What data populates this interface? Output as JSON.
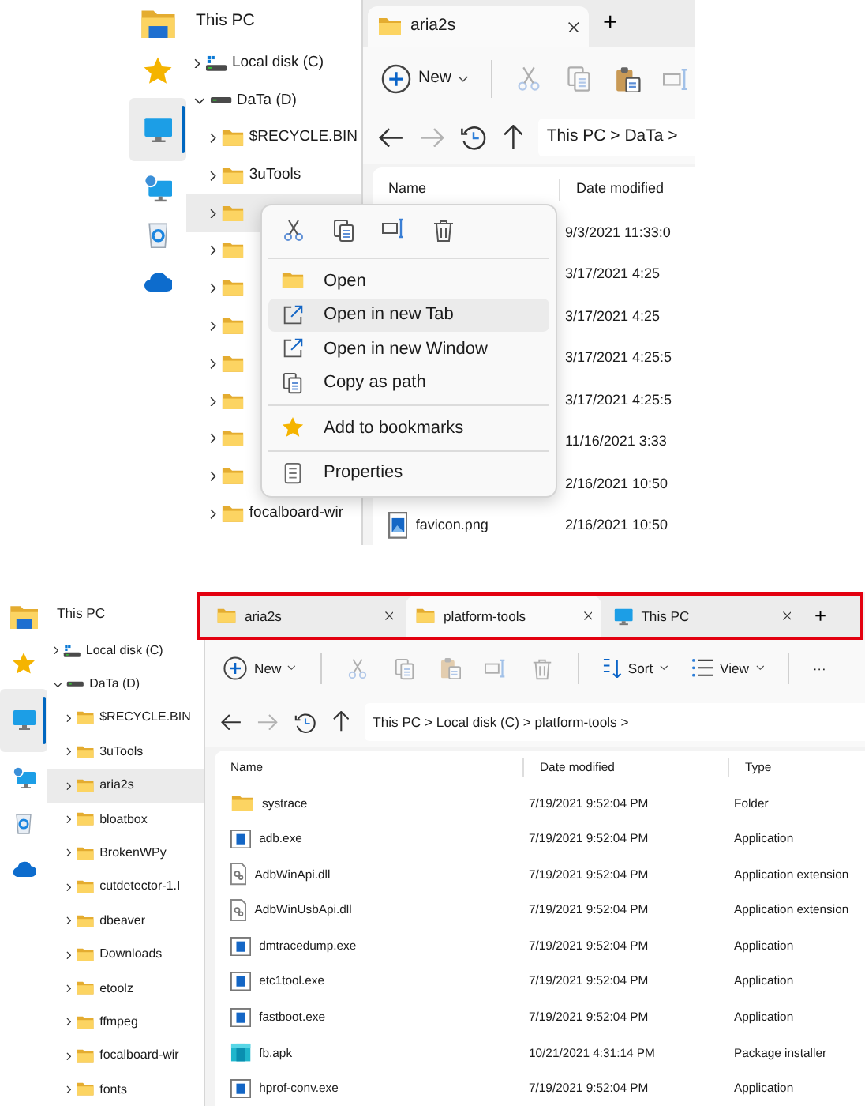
{
  "top_view": {
    "rail": [
      {
        "kind": "app",
        "selected": false
      },
      {
        "kind": "star",
        "selected": false
      },
      {
        "kind": "monitor",
        "selected": true
      },
      {
        "kind": "network",
        "selected": false
      },
      {
        "kind": "recycle",
        "selected": false
      },
      {
        "kind": "cloud",
        "selected": false
      }
    ],
    "nav_header": "This PC",
    "tree": [
      {
        "label": "Local disk (C)",
        "kind": "system_drive",
        "expanded": false,
        "hovered": false
      },
      {
        "label": "DaTa (D)",
        "kind": "drive",
        "expanded": true,
        "hovered": false,
        "children": [
          {
            "label": "$RECYCLE.BIN",
            "kind": "folder",
            "expanded": false,
            "hovered": false
          },
          {
            "label": "3uTools",
            "kind": "folder",
            "expanded": false,
            "hovered": false
          },
          {
            "kind": "folder",
            "expanded": false,
            "hovered": true
          },
          {
            "kind": "folder",
            "expanded": false,
            "hovered": false
          },
          {
            "kind": "folder",
            "expanded": false,
            "hovered": false
          },
          {
            "kind": "folder",
            "expanded": false,
            "hovered": false
          },
          {
            "kind": "folder",
            "expanded": false,
            "hovered": false
          },
          {
            "kind": "folder",
            "expanded": false,
            "hovered": false
          },
          {
            "kind": "folder",
            "expanded": false,
            "hovered": false
          },
          {
            "kind": "folder",
            "expanded": false,
            "hovered": false
          },
          {
            "label": "focalboard-wir",
            "kind": "folder",
            "expanded": false,
            "hovered": false
          }
        ]
      }
    ],
    "tabs_highlighted": false,
    "tabs": [
      {
        "label": "aria2s",
        "kind": "folder",
        "selected": true
      }
    ],
    "new_tab": "+",
    "toolbar": [
      {
        "kind": "new",
        "label": "New",
        "disabled": false
      },
      {
        "kind": "separator"
      },
      {
        "kind": "cut",
        "disabled": true
      },
      {
        "kind": "copy",
        "disabled": true
      },
      {
        "kind": "paste",
        "disabled": false
      },
      {
        "kind": "rename",
        "disabled": true
      }
    ],
    "nav_buttons": [
      {
        "kind": "back",
        "disabled": false
      },
      {
        "kind": "forward",
        "disabled": true
      },
      {
        "kind": "recent",
        "disabled": false
      },
      {
        "kind": "up",
        "disabled": false
      }
    ],
    "address": "This PC > DaTa >",
    "columns": [
      "Name",
      "Date modified"
    ],
    "rows": [
      {
        "date": "9/3/2021 11:33:0"
      },
      {
        "date": "3/17/2021 4:25"
      },
      {
        "date": "3/17/2021 4:25"
      },
      {
        "date": "3/17/2021 4:25:5"
      },
      {
        "date": "3/17/2021 4:25:5"
      },
      {
        "date": "11/16/2021 3:33"
      },
      {
        "date": "2/16/2021 10:50"
      },
      {
        "name": "favicon.png",
        "kind": "image",
        "date": "2/16/2021 10:50"
      }
    ],
    "context_menu": {
      "actions": [
        {
          "kind": "cut"
        },
        {
          "kind": "copy"
        },
        {
          "kind": "rename"
        },
        {
          "kind": "delete"
        }
      ],
      "items": [
        {
          "kind": "folder",
          "label": "Open",
          "highlighted": false
        },
        {
          "kind": "external_link",
          "label": "Open in new Tab",
          "highlighted": true
        },
        {
          "kind": "external_link",
          "label": "Open in new Window",
          "highlighted": false
        },
        {
          "kind": "copy_path",
          "label": "Copy as path",
          "highlighted": false
        },
        {
          "kind": "separator"
        },
        {
          "kind": "star",
          "label": "Add to bookmarks",
          "highlighted": false
        },
        {
          "kind": "separator"
        },
        {
          "kind": "properties",
          "label": "Properties",
          "highlighted": false
        }
      ]
    }
  },
  "bottom_view": {
    "rail": [
      {
        "kind": "app",
        "selected": false
      },
      {
        "kind": "star",
        "selected": false
      },
      {
        "kind": "monitor",
        "selected": true
      },
      {
        "kind": "network",
        "selected": false
      },
      {
        "kind": "recycle",
        "selected": false
      },
      {
        "kind": "cloud",
        "selected": false
      }
    ],
    "nav_header": "This PC",
    "tree": [
      {
        "label": "Local disk (C)",
        "kind": "system_drive",
        "expanded": false,
        "hovered": false
      },
      {
        "label": "DaTa (D)",
        "kind": "drive",
        "expanded": true,
        "hovered": false,
        "children": [
          {
            "label": "$RECYCLE.BIN",
            "kind": "folder",
            "expanded": false,
            "hovered": false
          },
          {
            "label": "3uTools",
            "kind": "folder",
            "expanded": false,
            "hovered": false
          },
          {
            "label": "aria2s",
            "kind": "folder",
            "expanded": false,
            "hovered": true
          },
          {
            "label": "bloatbox",
            "kind": "folder",
            "expanded": false,
            "hovered": false
          },
          {
            "label": "BrokenWPy",
            "kind": "folder",
            "expanded": false,
            "hovered": false
          },
          {
            "label": "cutdetector-1.I",
            "kind": "folder",
            "expanded": false,
            "hovered": false
          },
          {
            "label": "dbeaver",
            "kind": "folder",
            "expanded": false,
            "hovered": false
          },
          {
            "label": "Downloads",
            "kind": "folder",
            "expanded": false,
            "hovered": false
          },
          {
            "label": "etoolz",
            "kind": "folder",
            "expanded": false,
            "hovered": false
          },
          {
            "label": "ffmpeg",
            "kind": "folder",
            "expanded": false,
            "hovered": false
          },
          {
            "label": "focalboard-wir",
            "kind": "folder",
            "expanded": false,
            "hovered": false
          },
          {
            "label": "fonts",
            "kind": "folder",
            "expanded": false,
            "hovered": false
          }
        ]
      }
    ],
    "tabs_highlighted": true,
    "tabs": [
      {
        "label": "aria2s",
        "kind": "folder",
        "selected": false
      },
      {
        "label": "platform-tools",
        "kind": "folder",
        "selected": true
      },
      {
        "label": "This PC",
        "kind": "monitor",
        "selected": false
      }
    ],
    "new_tab": "+",
    "toolbar": [
      {
        "kind": "new",
        "label": "New",
        "disabled": false
      },
      {
        "kind": "separator"
      },
      {
        "kind": "cut",
        "disabled": true
      },
      {
        "kind": "copy",
        "disabled": true
      },
      {
        "kind": "paste",
        "disabled": true
      },
      {
        "kind": "rename",
        "disabled": true
      },
      {
        "kind": "delete",
        "disabled": true
      },
      {
        "kind": "separator"
      },
      {
        "kind": "sort",
        "label": "Sort",
        "disabled": false
      },
      {
        "kind": "view",
        "label": "View",
        "disabled": false
      },
      {
        "kind": "separator"
      },
      {
        "kind": "more",
        "label": "···",
        "disabled": false
      }
    ],
    "nav_buttons": [
      {
        "kind": "back",
        "disabled": false
      },
      {
        "kind": "forward",
        "disabled": true
      },
      {
        "kind": "recent",
        "disabled": false
      },
      {
        "kind": "up",
        "disabled": false
      }
    ],
    "address": "This PC > Local disk (C) > platform-tools >",
    "columns": [
      "Name",
      "Date modified",
      "Type"
    ],
    "rows": [
      {
        "name": "systrace",
        "kind": "folder",
        "date": "7/19/2021 9:52:04 PM",
        "type": "Folder"
      },
      {
        "name": "adb.exe",
        "kind": "exe",
        "date": "7/19/2021 9:52:04 PM",
        "type": "Application"
      },
      {
        "name": "AdbWinApi.dll",
        "kind": "dll",
        "date": "7/19/2021 9:52:04 PM",
        "type": "Application extension"
      },
      {
        "name": "AdbWinUsbApi.dll",
        "kind": "dll",
        "date": "7/19/2021 9:52:04 PM",
        "type": "Application extension"
      },
      {
        "name": "dmtracedump.exe",
        "kind": "exe",
        "date": "7/19/2021 9:52:04 PM",
        "type": "Application"
      },
      {
        "name": "etc1tool.exe",
        "kind": "exe",
        "date": "7/19/2021 9:52:04 PM",
        "type": "Application"
      },
      {
        "name": "fastboot.exe",
        "kind": "exe",
        "date": "7/19/2021 9:52:04 PM",
        "type": "Application"
      },
      {
        "name": "fb.apk",
        "kind": "apk",
        "date": "10/21/2021 4:31:14 PM",
        "type": "Package installer"
      },
      {
        "name": "hprof-conv.exe",
        "kind": "exe",
        "date": "7/19/2021 9:52:04 PM",
        "type": "Application"
      }
    ]
  }
}
